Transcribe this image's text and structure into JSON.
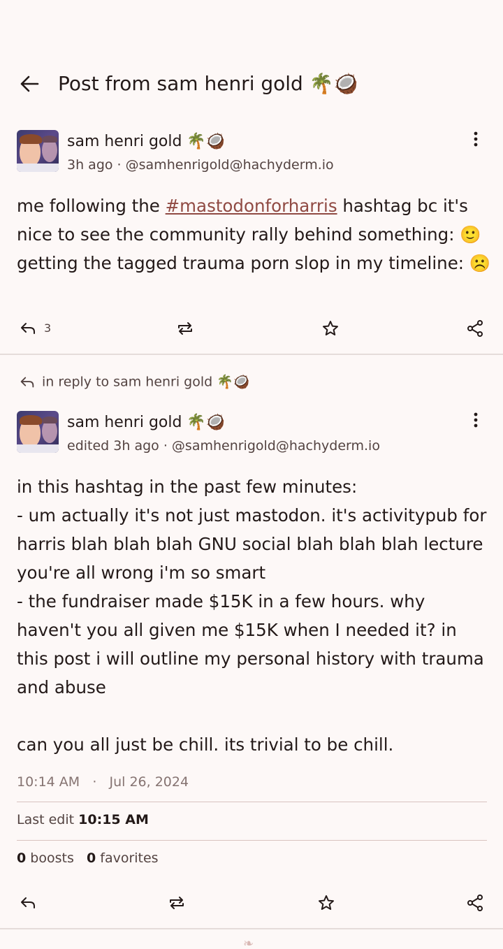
{
  "header": {
    "title": "Post from sam henri gold 🌴🥥"
  },
  "post1": {
    "author": "sam henri gold 🌴🥥",
    "time": "3h ago",
    "handle": "@samhenrigold@hachyderm.io",
    "text_before": "me following the ",
    "hashtag": "#mastodonforharris",
    "text_after": " hashtag bc it's nice to see the community rally behind something: 🙂 getting the tagged trauma porn slop in my timeline: ☹️",
    "reply_count": "3"
  },
  "post2": {
    "reply_to": "in reply to sam henri gold 🌴🥥",
    "author": "sam henri gold 🌴🥥",
    "time": "edited 3h ago",
    "handle": "@samhenrigold@hachyderm.io",
    "text": "in this hashtag in the past few minutes:\n- um actually it's not just mastodon. it's activitypub for harris blah blah blah GNU social blah blah blah lecture you're all wrong i'm so smart\n- the fundraiser made $15K in a few hours. why haven't you all given me $15K when I needed it? in this post i will outline my personal history with trauma and abuse\n\ncan you all just be chill. its trivial to be chill.",
    "posted_time": "10:14 AM",
    "posted_date": "Jul 26, 2024",
    "last_edit_label": "Last edit",
    "last_edit_time": "10:15 AM",
    "boosts_count": "0",
    "boosts_label": "boosts",
    "favorites_count": "0",
    "favorites_label": "favorites"
  },
  "icons": {
    "back": "arrow-left-icon",
    "more": "more-vertical-icon",
    "reply": "reply-icon",
    "boost": "repeat-icon",
    "favorite": "star-icon",
    "share": "share-icon"
  },
  "colors": {
    "accent": "#904a43",
    "background": "#fdf8f7",
    "text": "#231918",
    "muted": "#534341"
  }
}
